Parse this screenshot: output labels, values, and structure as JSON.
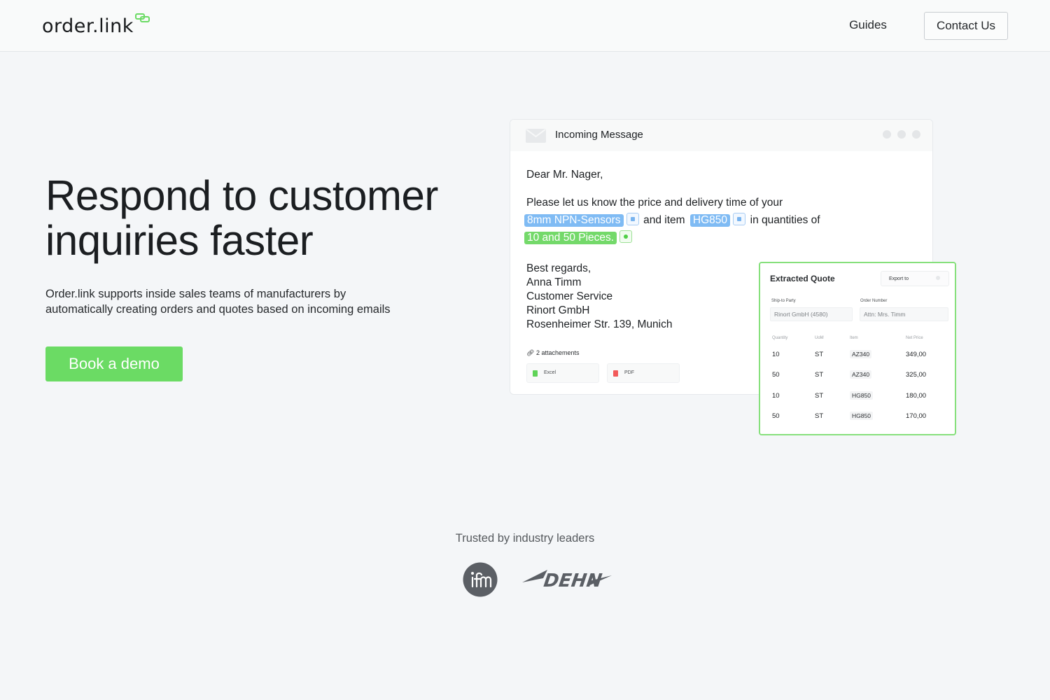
{
  "header": {
    "logo_text": "order.link",
    "nav": {
      "guides": "Guides",
      "contact": "Contact Us"
    }
  },
  "hero": {
    "title": "Respond to customer inquiries faster",
    "subtitle_line1": "Order.link supports inside sales teams of manufacturers by",
    "subtitle_line2": "automatically creating orders and quotes based on incoming emails",
    "cta": "Book a demo"
  },
  "message": {
    "title": "Incoming Message",
    "greeting": "Dear Mr. Nager,",
    "body_line1": "Please let us know the price and delivery time of your",
    "chip_sensors": "8mm NPN-Sensors",
    "text_and_item": "and item",
    "chip_item": "HG850",
    "text_quantities": "in quantities of",
    "chip_quantities": "10 and 50 Pieces.",
    "signature": [
      "Best regards,",
      "Anna Timm",
      "Customer Service",
      "Rinort GmbH",
      "Rosenheimer Str. 139, Munich"
    ],
    "attachments_label": "2 attachements",
    "files": [
      {
        "name": "Excel",
        "color": "#5fd357"
      },
      {
        "name": "PDF",
        "color": "#f25a5a"
      }
    ]
  },
  "quote": {
    "title": "Extracted Quote",
    "export_label": "Export to",
    "ship_to_label": "Ship-to Party",
    "ship_to_value": "Rinort GmbH (4580)",
    "order_number_label": "Order Number",
    "order_number_value": "Attn: Mrs. Timm",
    "columns": [
      "Quantity",
      "UoM",
      "Item",
      "Net Price"
    ],
    "rows": [
      [
        "10",
        "ST",
        "AZ340",
        "349,00"
      ],
      [
        "50",
        "ST",
        "AZ340",
        "325,00"
      ],
      [
        "10",
        "ST",
        "HG850",
        "180,00"
      ],
      [
        "50",
        "ST",
        "HG850",
        "170,00"
      ]
    ]
  },
  "trusted": {
    "label": "Trusted by industry leaders",
    "logos": [
      "ifm",
      "DEHN"
    ]
  },
  "colors": {
    "accent_green": "#6bdb64",
    "chip_blue": "#7fbbf4",
    "text": "#1c1f22"
  }
}
